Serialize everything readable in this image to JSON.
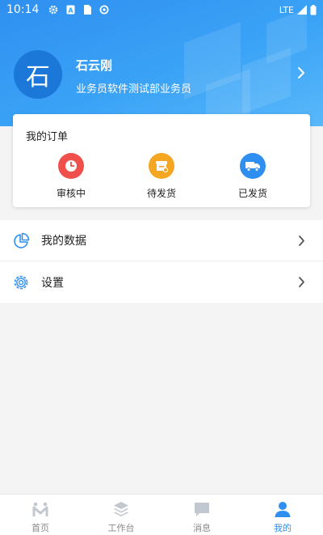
{
  "status_bar": {
    "time": "10:14",
    "network": "LTE"
  },
  "profile": {
    "avatar_text": "石",
    "name": "石云刚",
    "role": "业务员软件测试部业务员"
  },
  "orders": {
    "title": "我的订单",
    "items": [
      {
        "label": "审核中",
        "icon": "clock-icon",
        "color": "#f0504b"
      },
      {
        "label": "待发货",
        "icon": "package-icon",
        "color": "#f5a623"
      },
      {
        "label": "已发货",
        "icon": "truck-icon",
        "color": "#2e8ff0"
      }
    ]
  },
  "menu": [
    {
      "label": "我的数据",
      "icon": "pie-chart-icon"
    },
    {
      "label": "设置",
      "icon": "gear-icon"
    }
  ],
  "tabs": [
    {
      "label": "首页",
      "icon": "home-icon",
      "active": false
    },
    {
      "label": "工作台",
      "icon": "layers-icon",
      "active": false
    },
    {
      "label": "消息",
      "icon": "message-icon",
      "active": false
    },
    {
      "label": "我的",
      "icon": "user-icon",
      "active": true
    }
  ],
  "colors": {
    "accent": "#2f8ff0",
    "inactive_tab": "#888888"
  }
}
